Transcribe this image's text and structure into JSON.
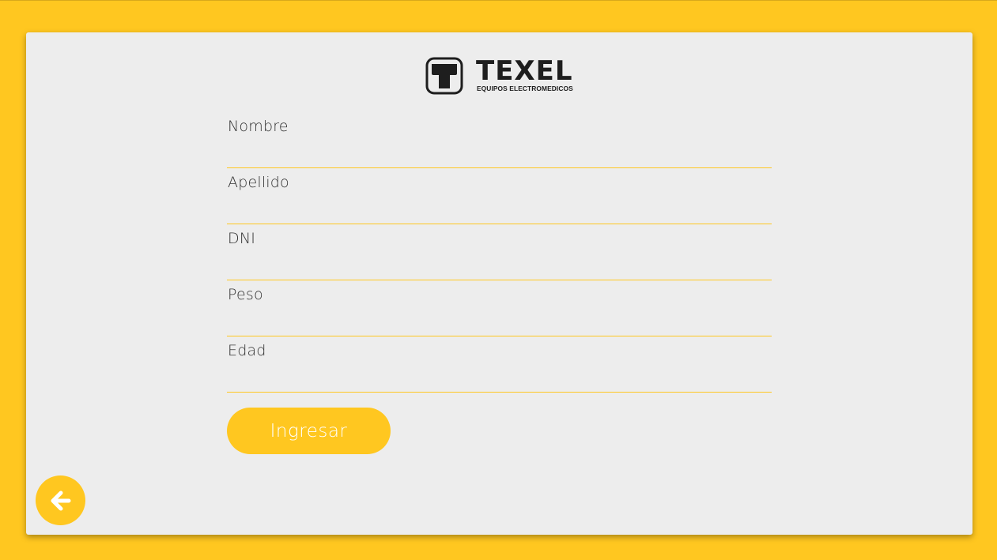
{
  "brand": {
    "name": "TEXEL",
    "tagline": "EQUIPOS ELECTROMEDICOS"
  },
  "form": {
    "fields": [
      {
        "label": "Nombre",
        "value": ""
      },
      {
        "label": "Apellido",
        "value": ""
      },
      {
        "label": "DNI",
        "value": ""
      },
      {
        "label": "Peso",
        "value": ""
      },
      {
        "label": "Edad",
        "value": ""
      }
    ],
    "submit_label": "Ingresar"
  },
  "nav": {
    "back_icon": "arrow-left-icon"
  },
  "colors": {
    "accent": "#FFC720",
    "card": "#EDEDED",
    "text": "#333333",
    "logo": "#1E1E1E"
  }
}
